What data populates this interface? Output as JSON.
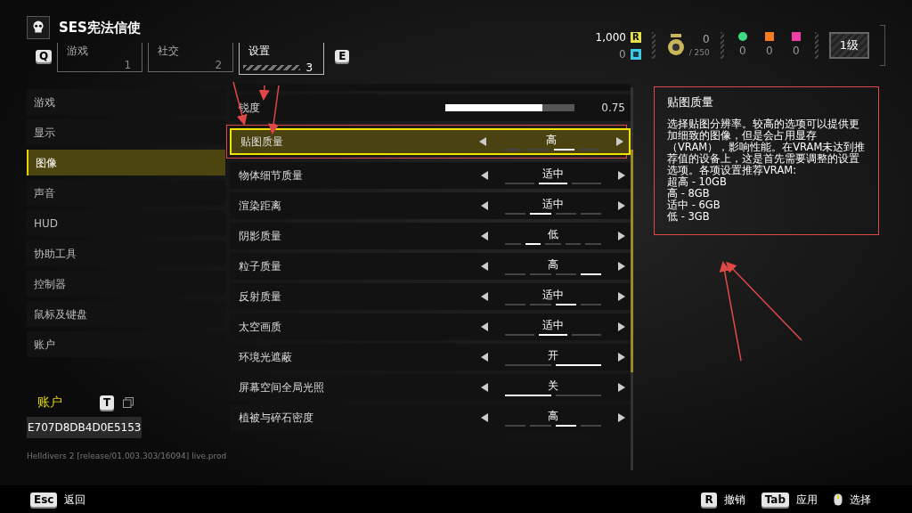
{
  "header": {
    "title": "SES宪法信使",
    "prev_key": "Q",
    "next_key": "E",
    "tabs": [
      {
        "label": "游戏",
        "number": "1",
        "selected": false
      },
      {
        "label": "社交",
        "number": "2",
        "selected": false
      },
      {
        "label": "设置",
        "number": "3",
        "selected": true
      }
    ],
    "currencies": [
      {
        "kind": "req",
        "amount": "1,000",
        "badge": "R"
      },
      {
        "kind": "super",
        "amount": "0"
      }
    ],
    "medals": {
      "amount": "0",
      "cap": "/ 250"
    },
    "samples": [
      {
        "color": "#3ddc84",
        "amount": "0"
      },
      {
        "color": "#f57c1f",
        "amount": "0"
      },
      {
        "color": "#ee3fa6",
        "amount": "0"
      }
    ],
    "level": "1级"
  },
  "sidebar": {
    "items": [
      {
        "label": "游戏",
        "selected": false
      },
      {
        "label": "显示",
        "selected": false
      },
      {
        "label": "图像",
        "selected": true
      },
      {
        "label": "声音",
        "selected": false
      },
      {
        "label": "HUD",
        "selected": false
      },
      {
        "label": "协助工具",
        "selected": false
      },
      {
        "label": "控制器",
        "selected": false
      },
      {
        "label": "鼠标及键盘",
        "selected": false
      },
      {
        "label": "账户",
        "selected": false
      }
    ],
    "account": {
      "title": "账户",
      "key": "T",
      "id": "E707D8DB4D0E5153"
    },
    "version": "Helldivers 2 [release/01.003.303/16094] live.prod"
  },
  "settings": [
    {
      "kind": "slider",
      "label": "锐度",
      "level": 0.75,
      "reading": "0.75",
      "selected": false
    },
    {
      "kind": "choice",
      "label": "贴图质量",
      "value": "高",
      "selected": true,
      "segments": [
        {
          "selected": false
        },
        {
          "selected": false
        },
        {
          "selected": true
        },
        {
          "selected": false
        }
      ]
    },
    {
      "kind": "choice",
      "label": "物体细节质量",
      "value": "适中",
      "selected": false,
      "segments": [
        {
          "selected": false
        },
        {
          "selected": true
        },
        {
          "selected": false
        }
      ]
    },
    {
      "kind": "choice",
      "label": "渲染距离",
      "value": "适中",
      "selected": false,
      "segments": [
        {
          "selected": false
        },
        {
          "selected": true
        },
        {
          "selected": false
        },
        {
          "selected": false
        }
      ]
    },
    {
      "kind": "choice",
      "label": "阴影质量",
      "value": "低",
      "selected": false,
      "segments": [
        {
          "selected": false
        },
        {
          "selected": true
        },
        {
          "selected": false
        },
        {
          "selected": false
        },
        {
          "selected": false
        }
      ]
    },
    {
      "kind": "choice",
      "label": "粒子质量",
      "value": "高",
      "selected": false,
      "segments": [
        {
          "selected": false
        },
        {
          "selected": false
        },
        {
          "selected": false
        },
        {
          "selected": true
        }
      ]
    },
    {
      "kind": "choice",
      "label": "反射质量",
      "value": "适中",
      "selected": false,
      "segments": [
        {
          "selected": false
        },
        {
          "selected": false
        },
        {
          "selected": true
        },
        {
          "selected": false
        }
      ]
    },
    {
      "kind": "choice",
      "label": "太空画质",
      "value": "适中",
      "selected": false,
      "segments": [
        {
          "selected": false
        },
        {
          "selected": true
        },
        {
          "selected": false
        }
      ]
    },
    {
      "kind": "choice",
      "label": "环境光遮蔽",
      "value": "开",
      "selected": false,
      "segments": [
        {
          "selected": false
        },
        {
          "selected": true
        }
      ]
    },
    {
      "kind": "choice",
      "label": "屏幕空间全局光照",
      "value": "关",
      "selected": false,
      "segments": [
        {
          "selected": true
        },
        {
          "selected": false
        }
      ]
    },
    {
      "kind": "choice",
      "label": "植被与碎石密度",
      "value": "高",
      "selected": false,
      "segments": [
        {
          "selected": false
        },
        {
          "selected": false
        },
        {
          "selected": true
        },
        {
          "selected": false
        }
      ]
    }
  ],
  "description": {
    "title": "贴图质量",
    "text": "选择贴图分辨率。较高的选项可以提供更加细致的图像，但是会占用显存（VRAM），影响性能。在VRAM未达到推荐值的设备上，这是首先需要调整的设置选项。各项设置推荐VRAM:",
    "lines": [
      "超高 - 10GB",
      "高 - 8GB",
      "适中 - 6GB",
      "低 - 3GB"
    ]
  },
  "footer": {
    "left": [
      {
        "key": "Esc",
        "label": "返回"
      }
    ],
    "right": [
      {
        "kind": "key",
        "key": "R",
        "label": "撤销"
      },
      {
        "kind": "key",
        "key": "Tab",
        "label": "应用"
      },
      {
        "kind": "mouse",
        "label": "选择"
      }
    ]
  }
}
